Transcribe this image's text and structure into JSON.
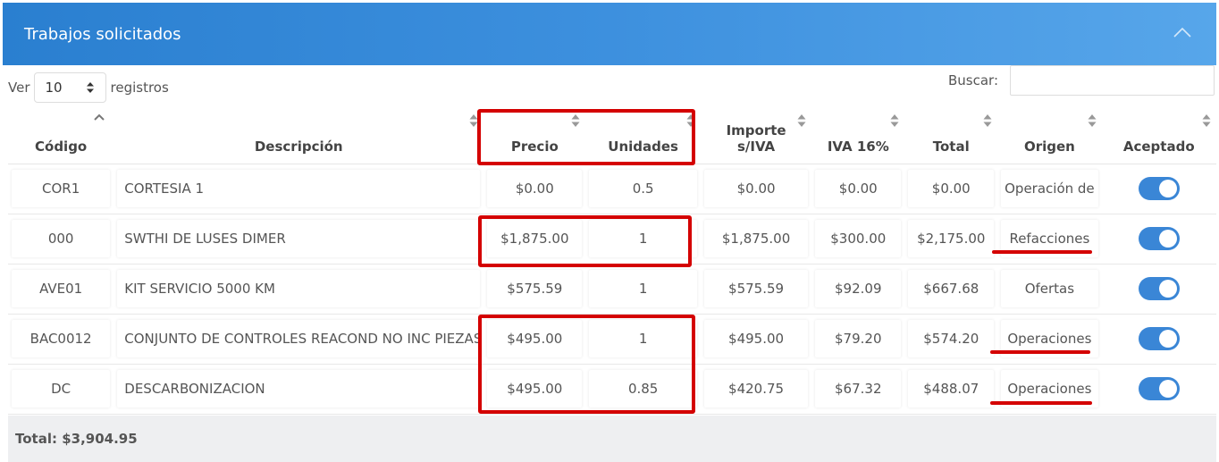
{
  "panel": {
    "title": "Trabajos solicitados",
    "collapse_icon": "chevron-up-icon"
  },
  "length": {
    "prefix": "Ver",
    "value": "10",
    "suffix": "registros"
  },
  "search": {
    "label": "Buscar:",
    "value": ""
  },
  "columns": {
    "codigo": "Código",
    "descripcion": "Descripción",
    "precio": "Precio",
    "unidades": "Unidades",
    "importe_line1": "Importe",
    "importe_line2": "s/IVA",
    "iva": "IVA 16%",
    "total": "Total",
    "origen": "Origen",
    "aceptado": "Aceptado"
  },
  "rows": [
    {
      "codigo": "COR1",
      "descripcion": "CORTESIA 1",
      "precio": "$0.00",
      "unidades": "0.5",
      "importe": "$0.00",
      "iva": "$0.00",
      "total": "$0.00",
      "origen": "Operación de",
      "aceptado": true
    },
    {
      "codigo": "000",
      "descripcion": "SWTHI DE LUSES DIMER",
      "precio": "$1,875.00",
      "unidades": "1",
      "importe": "$1,875.00",
      "iva": "$300.00",
      "total": "$2,175.00",
      "origen": "Refacciones",
      "aceptado": true
    },
    {
      "codigo": "AVE01",
      "descripcion": "KIT SERVICIO 5000 KM",
      "precio": "$575.59",
      "unidades": "1",
      "importe": "$575.59",
      "iva": "$92.09",
      "total": "$667.68",
      "origen": "Ofertas",
      "aceptado": true
    },
    {
      "codigo": "BAC0012",
      "descripcion": "CONJUNTO DE CONTROLES REACOND NO INC PIEZAS",
      "precio": "$495.00",
      "unidades": "1",
      "importe": "$495.00",
      "iva": "$79.20",
      "total": "$574.20",
      "origen": "Operaciones",
      "aceptado": true
    },
    {
      "codigo": "DC",
      "descripcion": "DESCARBONIZACION",
      "precio": "$495.00",
      "unidades": "0.85",
      "importe": "$420.75",
      "iva": "$67.32",
      "total": "$488.07",
      "origen": "Operaciones",
      "aceptado": true
    }
  ],
  "footer": {
    "total_label": "Total: $3,904.95"
  },
  "colors": {
    "header_gradient_start": "#2a7fd0",
    "header_gradient_end": "#57a6ea",
    "toggle_on": "#3a86d6",
    "annotation_red": "#d40000",
    "footer_bg": "#eeeff1"
  }
}
